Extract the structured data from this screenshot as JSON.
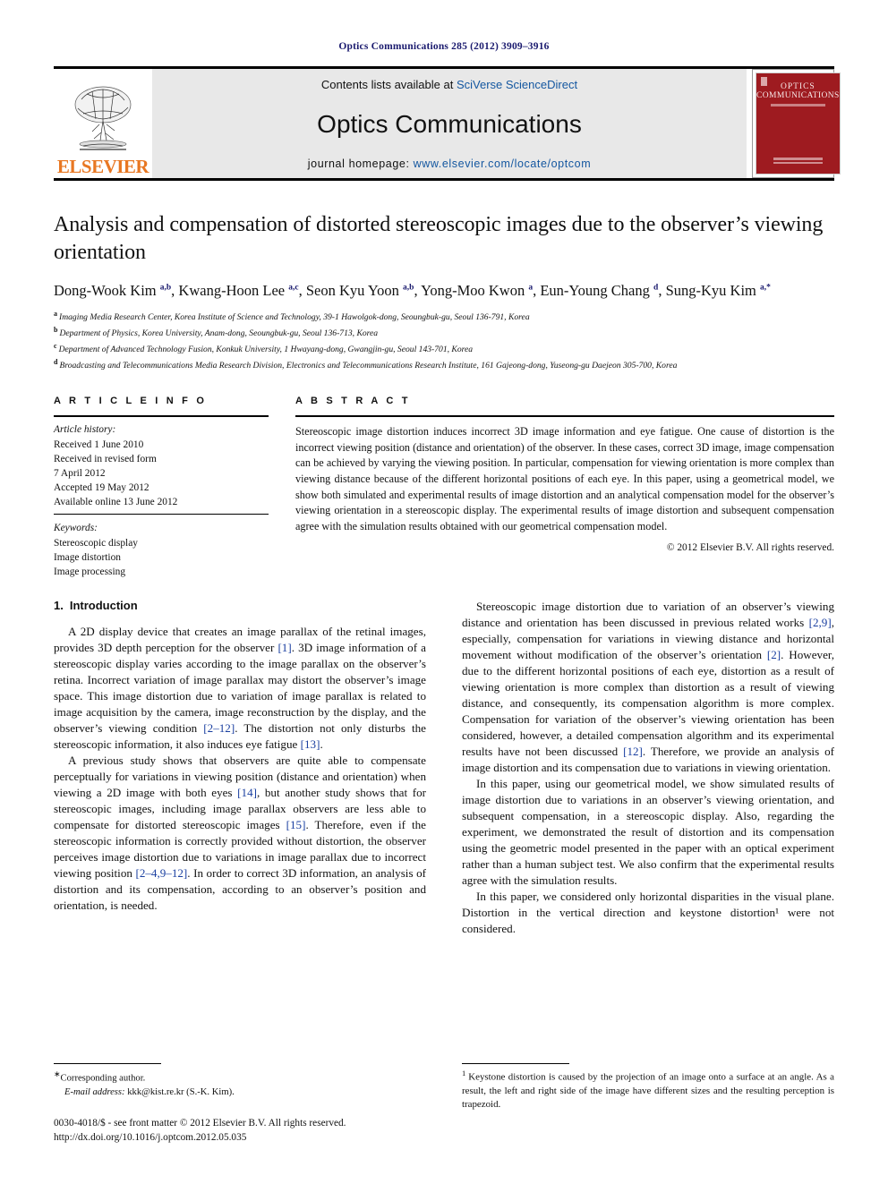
{
  "running_head": "Optics Communications 285 (2012) 3909–3916",
  "masthead": {
    "contents_prefix": "Contents lists available at ",
    "contents_link": "SciVerse ScienceDirect",
    "journal_name": "Optics Communications",
    "homepage_prefix": "journal homepage: ",
    "homepage_url": "www.elsevier.com/locate/optcom",
    "publisher": "ELSEVIER",
    "cover": {
      "line1": "OPTICS",
      "line2": "COMMUNICATIONS"
    },
    "link_color": "#1457a0",
    "elsevier_orange": "#E87722",
    "cover_red": "#9e1b20"
  },
  "article": {
    "title": "Analysis and compensation of distorted stereoscopic images due to the observer’s viewing orientation",
    "authors_html": "Dong-Wook Kim <sup>a,b</sup>, Kwang-Hoon Lee <sup>a,c</sup>, Seon Kyu Yoon <sup>a,b</sup>, Yong-Moo Kwon <sup>a</sup>, Eun-Young Chang <sup>d</sup>, Sung-Kyu Kim <sup>a,*</sup>",
    "affiliations": [
      {
        "mark": "a",
        "text": "Imaging Media Research Center, Korea Institute of Science and Technology, 39-1 Hawolgok-dong, Seoungbuk-gu, Seoul 136-791, Korea"
      },
      {
        "mark": "b",
        "text": "Department of Physics, Korea University, Anam-dong, Seoungbuk-gu, Seoul 136-713, Korea"
      },
      {
        "mark": "c",
        "text": "Department of Advanced Technology Fusion, Konkuk University, 1 Hwayang-dong, Gwangjin-gu, Seoul 143-701, Korea"
      },
      {
        "mark": "d",
        "text": "Broadcasting and Telecommunications Media Research Division, Electronics and Telecommunications Research Institute, 161 Gajeong-dong, Yuseong-gu Daejeon 305-700, Korea"
      }
    ]
  },
  "info": {
    "heading": "A R T I C L E   I N F O",
    "history_label": "Article history:",
    "history": [
      "Received 1 June 2010",
      "Received in revised form",
      "7 April 2012",
      "Accepted 19 May 2012",
      "Available online 13 June 2012"
    ],
    "keywords_label": "Keywords:",
    "keywords": [
      "Stereoscopic display",
      "Image distortion",
      "Image processing"
    ]
  },
  "abstract": {
    "heading": "A B S T R A C T",
    "text": "Stereoscopic image distortion induces incorrect 3D image information and eye fatigue. One cause of distortion is the incorrect viewing position (distance and orientation) of the observer. In these cases, correct 3D image, image compensation can be achieved by varying the viewing position. In particular, compensation for viewing orientation is more complex than viewing distance because of the different horizontal positions of each eye. In this paper, using a geometrical model, we show both simulated and experimental results of image distortion and an analytical compensation model for the observer’s viewing orientation in a stereoscopic display. The experimental results of image distortion and subsequent compensation agree with the simulation results obtained with our geometrical compensation model.",
    "copyright": "© 2012 Elsevier B.V. All rights reserved."
  },
  "section": {
    "number": "1.",
    "title": "Introduction"
  },
  "body": {
    "left_paragraphs": [
      "A 2D display device that creates an image parallax of the retinal images, provides 3D depth perception for the observer [1]. 3D image information of a stereoscopic display varies according to the image parallax on the observer’s retina. Incorrect variation of image parallax may distort the observer’s image space. This image distortion due to variation of image parallax is related to image acquisition by the camera, image reconstruction by the display, and the observer’s viewing condition [2–12]. The distortion not only disturbs the stereoscopic information, it also induces eye fatigue [13].",
      "A previous study shows that observers are quite able to compensate perceptually for variations in viewing position (distance and orientation) when viewing a 2D image with both eyes [14], but another study shows that for stereoscopic images, including image parallax observers are less able to compensate for distorted stereoscopic images [15]. Therefore, even if the stereoscopic information is correctly provided without distortion, the observer perceives image distortion due to variations in image parallax due to incorrect viewing position [2–4,9–12]. In order to correct 3D information, an analysis of distortion and its compensation, according to an observer’s position and orientation, is needed."
    ],
    "right_paragraphs": [
      "Stereoscopic image distortion due to variation of an observer’s viewing distance and orientation has been discussed in previous related works [2,9], especially, compensation for variations in viewing distance and horizontal movement without modification of the observer’s orientation [2]. However, due to the different horizontal positions of each eye, distortion as a result of viewing orientation is more complex than distortion as a result of viewing distance, and consequently, its compensation algorithm is more complex. Compensation for variation of the observer’s viewing orientation has been considered, however, a detailed compensation algorithm and its experimental results have not been discussed [12]. Therefore, we provide an analysis of image distortion and its compensation due to variations in viewing orientation.",
      "In this paper, using our geometrical model, we show simulated results of image distortion due to variations in an observer’s viewing orientation, and subsequent compensation, in a stereoscopic display. Also, regarding the experiment, we demonstrated the result of distortion and its compensation using the geometric model presented in the paper with an optical experiment rather than a human subject test. We also confirm that the experimental results agree with the simulation results.",
      "In this paper, we considered only horizontal disparities in the visual plane. Distortion in the vertical direction and keystone distortion¹ were not considered."
    ]
  },
  "footer": {
    "corresponding_label": "Corresponding author.",
    "email_label": "E-mail address:",
    "email_value": "kkk@kist.re.kr (S.-K. Kim).",
    "issn_line": "0030-4018/$ - see front matter © 2012 Elsevier B.V. All rights reserved.",
    "doi_line": "http://dx.doi.org/10.1016/j.optcom.2012.05.035",
    "footnote_number": "1",
    "footnote_text": "Keystone distortion is caused by the projection of an image onto a surface at an angle. As a result, the left and right side of the image have different sizes and the resulting perception is trapezoid."
  }
}
